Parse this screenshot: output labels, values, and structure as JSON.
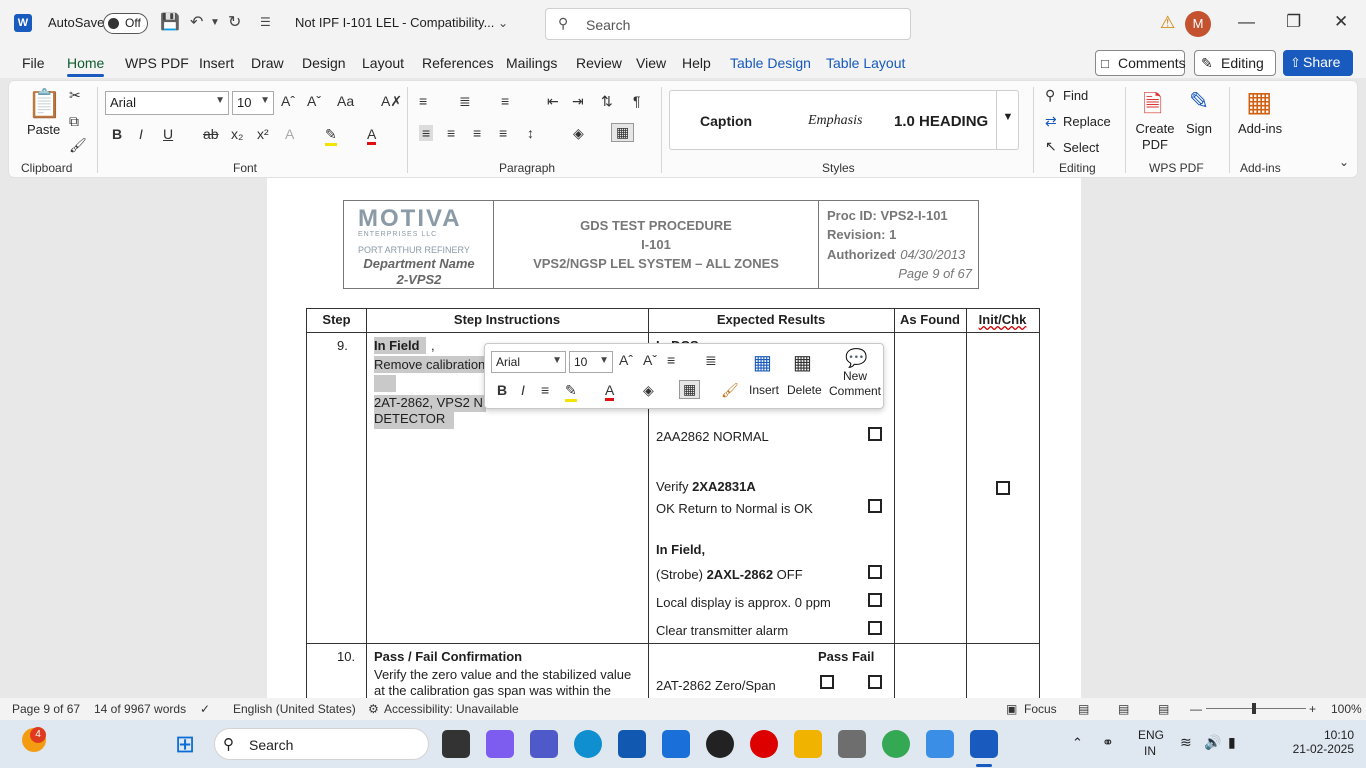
{
  "titlebar": {
    "app_logo": "W",
    "autosave_label": "AutoSave",
    "autosave_state": "Off",
    "doc_title": "Not IPF I-101 LEL  -  Compatibility...",
    "search_placeholder": "Search",
    "avatar_initial": "M"
  },
  "menu": {
    "tabs": [
      "File",
      "Home",
      "WPS PDF",
      "Insert",
      "Draw",
      "Design",
      "Layout",
      "References",
      "Mailings",
      "Review",
      "View",
      "Help",
      "Table Design",
      "Table Layout"
    ],
    "comments": "Comments",
    "editing": "Editing",
    "share": "Share"
  },
  "ribbon": {
    "paste": "Paste",
    "font_name": "Arial",
    "font_size": "10",
    "groups": [
      "Clipboard",
      "Font",
      "Paragraph",
      "Styles",
      "Editing",
      "WPS PDF",
      "Add-ins"
    ],
    "styles": [
      "Caption",
      "Emphasis",
      "1.0  HEADING"
    ],
    "find": "Find",
    "replace": "Replace",
    "select": "Select",
    "create_pdf": "Create PDF",
    "sign": "Sign",
    "addins": "Add-ins"
  },
  "doc_header": {
    "logo": "MOTIVA",
    "logo_sub": "ENTERPRISES LLC",
    "refinery": "PORT ARTHUR REFINERY",
    "dept_line1": "Department Name",
    "dept_line2": "2-VPS2",
    "title_line1": "GDS TEST PROCEDURE",
    "title_line2": "I-101",
    "title_line3": "VPS2/NGSP LEL SYSTEM – ALL ZONES",
    "proc_id": "Proc ID: VPS2-I-101",
    "revision": "Revision: 1",
    "authorized_label": "Authorized",
    "authorized_date": ": 04/30/2013",
    "page": "Page 9 of 67"
  },
  "table": {
    "headers": [
      "Step",
      "Step Instructions",
      "Expected Results",
      "As Found",
      "Init/Chk"
    ],
    "row9": {
      "step": "9.",
      "in_field": "In Field",
      "comma": ",",
      "line2": "Remove calibration",
      "line3": "2AT-2862, VPS2 N",
      "line4": "DETECTOR",
      "results": {
        "top": "In DCS",
        "r1": "2AA2862 NORMAL",
        "r2_pre": "Verify ",
        "r2_bold": "2XA2831A",
        "r3": "OK Return to Normal is OK",
        "r4": "In Field,",
        "r5_pre": "(Strobe) ",
        "r5_bold": "2AXL-2862",
        "r5_post": " OFF",
        "r6": "Local display is approx. 0 ppm",
        "r7": "Clear transmitter alarm"
      }
    },
    "row10": {
      "step": "10.",
      "title": "Pass / Fail Confirmation",
      "line2": "Verify the zero value and the stabilized value",
      "line3": "at the calibration gas span was within the",
      "pass_fail": "Pass Fail",
      "r1": "2AT-2862 Zero/Span"
    }
  },
  "minibar": {
    "font_name": "Arial",
    "font_size": "10",
    "insert": "Insert",
    "delete": "Delete",
    "new_comment": "New Comment"
  },
  "statusbar": {
    "page": "Page 9 of 67",
    "words": "14 of 9967 words",
    "language": "English (United States)",
    "accessibility": "Accessibility: Unavailable",
    "focus": "Focus",
    "zoom": "100%"
  },
  "taskbar": {
    "search_placeholder": "Search",
    "badge": "4",
    "lang1": "ENG",
    "lang2": "IN",
    "time": "10:10",
    "date": "21-02-2025"
  },
  "colors": {
    "accent": "#185abd",
    "warn": "#d18000",
    "selection": "#c9c9c9"
  }
}
